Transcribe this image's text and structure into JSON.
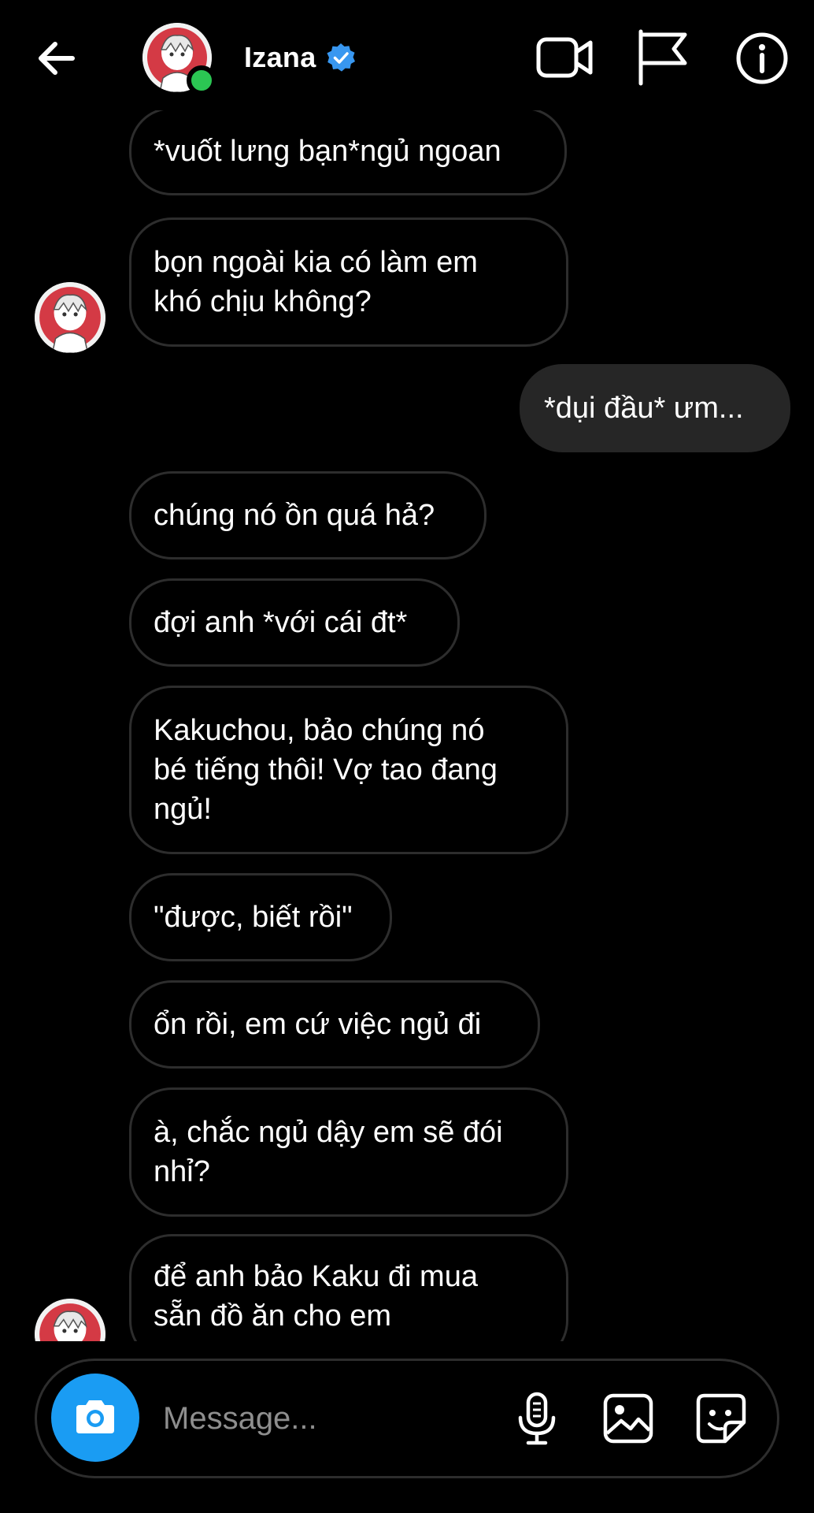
{
  "header": {
    "name": "Izana",
    "verified": true,
    "online": true,
    "icons": {
      "back": "arrow-left-icon",
      "video": "video-camera-icon",
      "flag": "flag-icon",
      "info": "info-icon"
    }
  },
  "messages": [
    {
      "side": "them",
      "text": "*vuốt lưng bạn*ngủ ngoan"
    },
    {
      "side": "them",
      "lines": [
        "bọn ngoài kia có làm em",
        "khó chịu không?"
      ]
    },
    {
      "side": "me",
      "text": "*dụi đầu* ưm..."
    },
    {
      "side": "them",
      "text": "chúng nó ồn quá hả?"
    },
    {
      "side": "them",
      "text": "đợi anh *với cái đt*"
    },
    {
      "side": "them",
      "lines": [
        "Kakuchou, bảo chúng nó",
        "bé tiếng thôi! Vợ tao đang",
        "ngủ!"
      ]
    },
    {
      "side": "them",
      "text": "\"được, biết rồi\""
    },
    {
      "side": "them",
      "text": "ổn rồi, em cứ việc ngủ đi"
    },
    {
      "side": "them",
      "lines": [
        "à, chắc ngủ dậy em sẽ đói",
        "nhỉ?"
      ]
    },
    {
      "side": "them",
      "lines": [
        "để anh bảo Kaku đi mua",
        "sẵn đồ ăn cho em"
      ]
    }
  ],
  "composer": {
    "placeholder": "Message...",
    "icons": [
      "camera-icon",
      "microphone-icon",
      "gallery-icon",
      "sticker-icon"
    ]
  },
  "colors": {
    "background": "#000000",
    "bubble_border": "#2d2d2d",
    "my_bubble": "#262626",
    "accent_blue": "#1a9cf3",
    "verified_blue": "#3897f0",
    "online_green": "#2bc653",
    "placeholder_gray": "#8e8e8e"
  }
}
